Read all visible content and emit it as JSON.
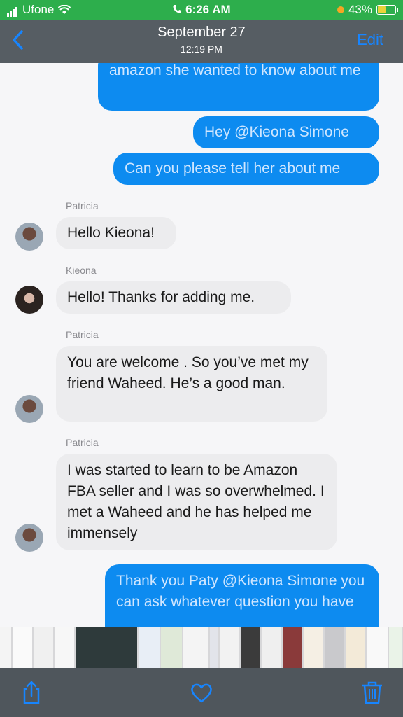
{
  "status": {
    "carrier": "Ufone",
    "time": "6:26 AM",
    "battery": "43%"
  },
  "nav": {
    "title": "September 27",
    "subtitle": "12:19 PM",
    "edit_label": "Edit",
    "back_icon": "chevron-left-icon"
  },
  "messages": [
    {
      "type": "out",
      "text": "amazon she wanted to know about me"
    },
    {
      "type": "out",
      "text": "Hey @Kieona Simone"
    },
    {
      "type": "out",
      "text": "Can you please tell her about me"
    },
    {
      "type": "in",
      "sender": "Patricia",
      "text": "Hello Kieona!"
    },
    {
      "type": "in",
      "sender": "Kieona",
      "text": "Hello! Thanks for adding me."
    },
    {
      "type": "in",
      "sender": "Patricia",
      "text": "You are welcome . So you’ve met my friend Waheed. He’s a good man."
    },
    {
      "type": "in",
      "sender": "Patricia",
      "text": "I was started to learn to be Amazon FBA seller and I was so overwhelmed. I met a Waheed and he has helped me immensely"
    },
    {
      "type": "out",
      "text": "Thank you Paty @Kieona Simone you can ask whatever question you have"
    }
  ],
  "toolbar": {
    "share_icon": "share-icon",
    "favorite_icon": "heart-icon",
    "delete_icon": "trash-icon"
  },
  "colors": {
    "status_bar": "#2dae4c",
    "nav_bar": "#565d63",
    "outgoing_bubble": "#0d8bf0",
    "incoming_bubble": "#ececee",
    "accent": "#1785ff"
  }
}
